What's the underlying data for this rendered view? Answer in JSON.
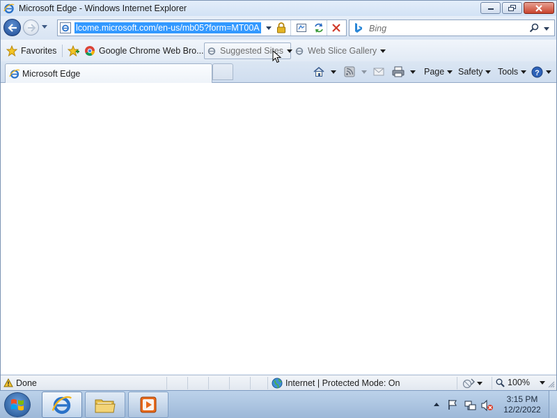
{
  "window": {
    "title": "Microsoft Edge - Windows Internet Explorer"
  },
  "address": {
    "url": "lcome.microsoft.com/en-us/mb05?form=MT00A"
  },
  "search": {
    "placeholder": "Bing"
  },
  "favorites_bar": {
    "favorites_label": "Favorites",
    "items": [
      {
        "label": "Google Chrome Web Bro..."
      },
      {
        "label": "Suggested Sites"
      },
      {
        "label": "Web Slice Gallery"
      }
    ]
  },
  "tabs": {
    "active_label": "Microsoft Edge"
  },
  "command_bar": {
    "page_label": "Page",
    "safety_label": "Safety",
    "tools_label": "Tools"
  },
  "status_bar": {
    "status_text": "Done",
    "zone_text": "Internet | Protected Mode: On",
    "zoom_text": "100%"
  },
  "taskbar": {
    "time": "3:15 PM",
    "date": "12/2/2022"
  },
  "colors": {
    "accent": "#3399ff",
    "chrome": "#dfe9f5"
  },
  "icons": [
    "ie-icon",
    "back-arrow-icon",
    "forward-arrow-icon",
    "lock-icon",
    "compatibility-view-icon",
    "refresh-icon",
    "stop-icon",
    "bing-icon",
    "search-icon",
    "favorites-star-icon",
    "add-favorites-icon",
    "chrome-icon",
    "home-icon",
    "feeds-icon",
    "read-mail-icon",
    "print-icon",
    "help-icon",
    "warning-icon",
    "globe-icon",
    "zoom-icon",
    "windows-logo-icon",
    "folder-icon",
    "media-player-icon",
    "flag-icon",
    "network-icon",
    "volume-muted-icon"
  ]
}
